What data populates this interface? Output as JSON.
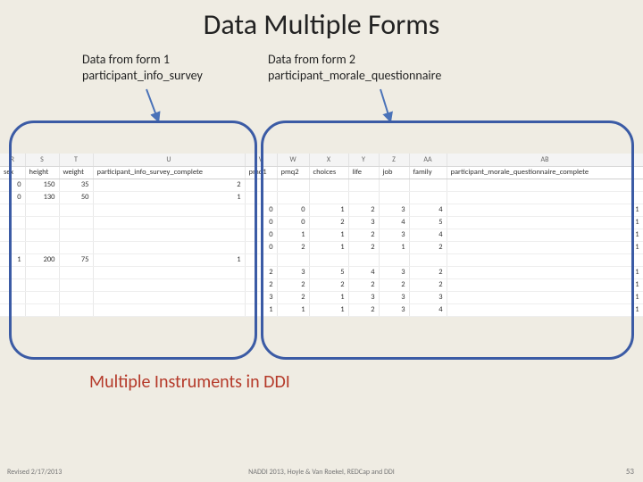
{
  "title": "Data Multiple Forms",
  "label1_line1": "Data from form 1",
  "label1_line2": "participant_info_survey",
  "label2_line1": "Data from form 2",
  "label2_line2": "participant_morale_questionnaire",
  "subtitle": "Multiple Instruments in DDI",
  "footer_left": "Revised 2/17/2013",
  "footer_center": "NADDI 2013, Hoyle & Van Roekel, REDCap and DDI",
  "footer_right": "53",
  "col_letters": [
    "R",
    "S",
    "T",
    "U",
    "V",
    "W",
    "X",
    "Y",
    "Z",
    "AA",
    "AB"
  ],
  "field_names": [
    "sex",
    "height",
    "weight",
    "participant_info_survey_complete",
    "pmq1",
    "pmq2",
    "choices",
    "life",
    "job",
    "family",
    "participant_morale_questionnaire_complete"
  ],
  "rows": [
    [
      "0",
      "150",
      "35",
      "2",
      "",
      "",
      "",
      "",
      "",
      "",
      ""
    ],
    [
      "0",
      "130",
      "50",
      "1",
      "",
      "",
      "",
      "",
      "",
      "",
      ""
    ],
    [
      "",
      "",
      "",
      "",
      "0",
      "0",
      "1",
      "2",
      "3",
      "4",
      "1"
    ],
    [
      "",
      "",
      "",
      "",
      "0",
      "0",
      "2",
      "3",
      "4",
      "5",
      "1"
    ],
    [
      "",
      "",
      "",
      "",
      "0",
      "1",
      "1",
      "2",
      "3",
      "4",
      "1"
    ],
    [
      "",
      "",
      "",
      "",
      "0",
      "2",
      "1",
      "2",
      "1",
      "2",
      "1"
    ],
    [
      "1",
      "200",
      "75",
      "1",
      "",
      "",
      "",
      "",
      "",
      "",
      ""
    ],
    [
      "",
      "",
      "",
      "",
      "2",
      "3",
      "5",
      "4",
      "3",
      "2",
      "1"
    ],
    [
      "",
      "",
      "",
      "",
      "2",
      "2",
      "2",
      "2",
      "2",
      "2",
      "1"
    ],
    [
      "",
      "",
      "",
      "",
      "3",
      "2",
      "1",
      "3",
      "3",
      "3",
      "1"
    ],
    [
      "",
      "",
      "",
      "",
      "1",
      "1",
      "1",
      "2",
      "3",
      "4",
      "1"
    ]
  ]
}
